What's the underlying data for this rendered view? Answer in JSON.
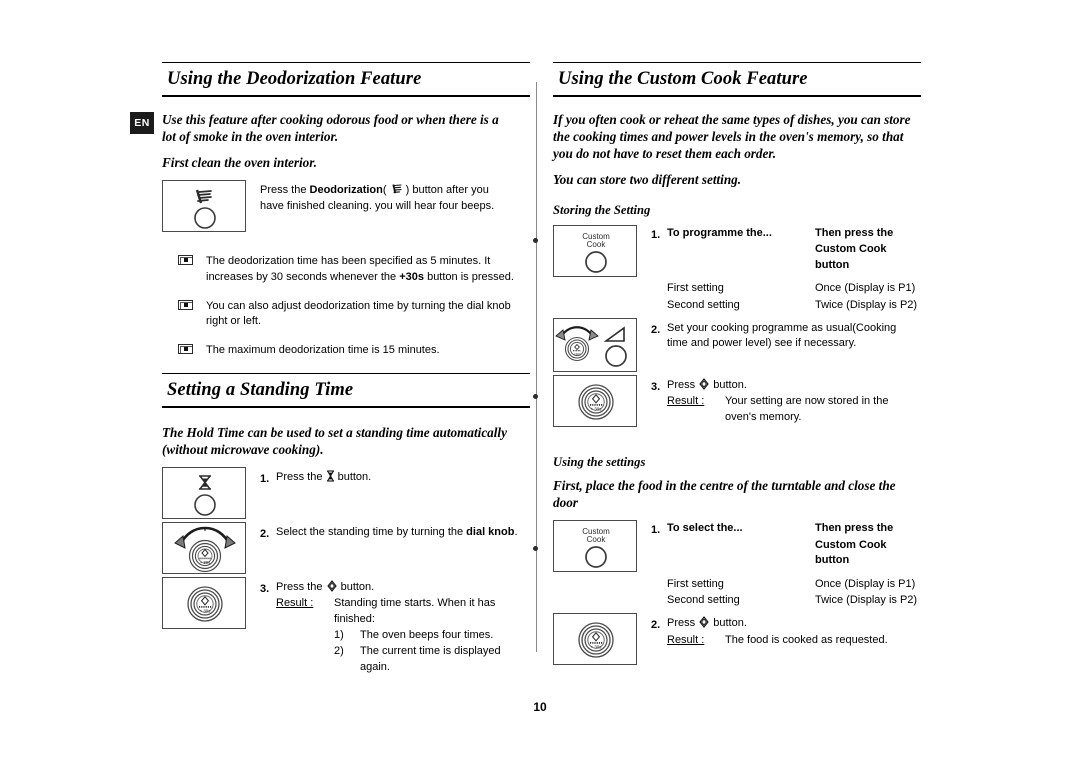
{
  "locale_tab": "EN",
  "page_number": "10",
  "left_column": {
    "section1": {
      "title": "Using the Deodorization Feature",
      "intro1": "Use this feature after cooking odorous food or when there is a lot of smoke in the oven interior.",
      "intro2": "First clean the oven interior.",
      "step_text_a": "Press the ",
      "step_text_b": "Deodorization",
      "step_text_c": "( ",
      "step_text_d": " ) button after you have finished cleaning. you will hear four beeps.",
      "notes": [
        "The deodorization time has been specified as 5 minutes. It increases by 30 seconds whenever the +30s button is pressed.",
        "You can also adjust deodorization time by turning the dial knob right or left.",
        "The maximum deodorization time is 15 minutes."
      ],
      "note1_part1": "The deodorization time has been specified as 5 minutes. It increases by 30 seconds whenever the ",
      "note1_bold": "+30s",
      "note1_part2": " button is pressed.",
      "note2": "You can also adjust deodorization time by turning the dial knob right or left.",
      "note3": "The maximum deodorization time is 15 minutes."
    },
    "section2": {
      "title": "Setting a Standing Time",
      "intro1": "The Hold Time can be used to set a standing time automatically (without microwave cooking).",
      "steps": [
        {
          "num": "1.",
          "text_a": "Press the ",
          "text_b": " button.",
          "icon": "hourglass-icon"
        },
        {
          "num": "2.",
          "text_a": "Select the standing time by turning the ",
          "bold": "dial knob",
          "text_b": ".",
          "icon": "dial-knob-icon"
        },
        {
          "num": "3.",
          "text_a": "Press the ",
          "text_b": " button.",
          "result_label": "Result :",
          "result_text": "Standing time starts. When it has finished:",
          "sub1_mk": "1)",
          "sub1": "The oven beeps four times.",
          "sub2_mk": "2)",
          "sub2": "The current time is displayed again.",
          "icon": "start-button-icon"
        }
      ]
    }
  },
  "right_column": {
    "section1": {
      "title": "Using the Custom Cook Feature",
      "intro1": "If you often cook or reheat the same types of dishes, you can store the cooking times and power levels in the oven's memory, so that you do not have to reset them each order.",
      "intro2": "You can store two different setting.",
      "subhead1": "Storing the Setting",
      "button_label_line1": "Custom",
      "button_label_line2": "Cook",
      "step1": {
        "num": "1.",
        "col1_header": "To programme the...",
        "col2_header_line1": "Then press the",
        "col2_header_line2": "Custom Cook button",
        "row1_col1": "First setting",
        "row1_col2": "Once (Display is P1)",
        "row2_col1": "Second setting",
        "row2_col2": "Twice (Display is P2)"
      },
      "step2": {
        "num": "2.",
        "text": "Set your cooking programme as usual(Cooking time and power level) see if necessary."
      },
      "step3": {
        "num": "3.",
        "text_a": "Press ",
        "text_b": " button.",
        "result_label": "Result :",
        "result_text": "Your setting are now stored in the oven's memory."
      },
      "subhead2": "Using the settings",
      "intro3": "First, place the food in the centre of the turntable and close the door",
      "step4": {
        "num": "1.",
        "col1_header": "To select the...",
        "col2_header_line1": "Then press the",
        "col2_header_line2": "Custom Cook button",
        "row1_col1": "First setting",
        "row1_col2": "Once (Display is P1)",
        "row2_col1": "Second setting",
        "row2_col2": "Twice (Display is P2)"
      },
      "step5": {
        "num": "2.",
        "text_a": "Press ",
        "text_b": " button.",
        "result_label": "Result :",
        "result_text": "The food is cooked as requested."
      }
    }
  }
}
